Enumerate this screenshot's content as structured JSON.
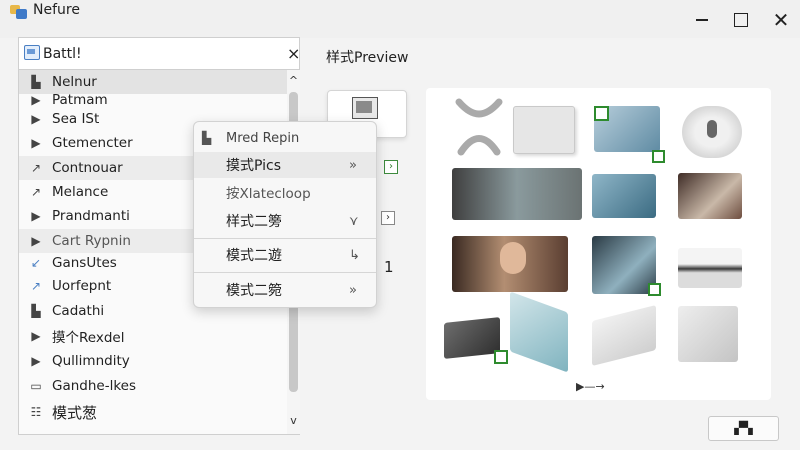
{
  "window": {
    "title": "Nefure",
    "close_glyph": "✕"
  },
  "search": {
    "value": "Battl!",
    "clear_glyph": "×"
  },
  "list": {
    "items": [
      {
        "label": "Nelnur",
        "icon": "▙"
      },
      {
        "label": "Patmam",
        "icon": "▶"
      },
      {
        "label": "Sea ISt",
        "icon": "▶"
      },
      {
        "label": "Gtemencter",
        "icon": "▶"
      },
      {
        "label": "Contnouar",
        "icon": "↗"
      },
      {
        "label": "Melance",
        "icon": "↗"
      },
      {
        "label": "Prandmanti",
        "icon": "▶"
      },
      {
        "label": "Cart Rypnin",
        "icon": "▶"
      },
      {
        "label": "GansUtes",
        "icon": "↙"
      },
      {
        "label": "Uorfepnt",
        "icon": "↗"
      },
      {
        "label": "Cadathi",
        "icon": "▙"
      },
      {
        "label": "摸个Rexdel",
        "icon": "▶"
      },
      {
        "label": "Qullimndity",
        "icon": "▶"
      },
      {
        "label": "Gandhe-lkes",
        "icon": "▭"
      },
      {
        "label": "模式葱",
        "icon": "☷"
      }
    ],
    "scroll_up": "^",
    "scroll_down": "v"
  },
  "preview": {
    "title": "样式Preview",
    "number": "1"
  },
  "context_menu": {
    "items": [
      {
        "label": "Mred Repin",
        "arrow": ""
      },
      {
        "label": "摸式Pics",
        "arrow": "»"
      },
      {
        "label": "按Xlatecloop",
        "arrow": ""
      },
      {
        "label": "样式二篣",
        "arrow": "⋎"
      },
      {
        "label": "模式二遊",
        "arrow": "↳"
      },
      {
        "label": "模式二箢",
        "arrow": "»"
      }
    ]
  },
  "gallery": {
    "next_arrow": "▶—→"
  },
  "corner_button": {
    "label": "▞▚"
  }
}
